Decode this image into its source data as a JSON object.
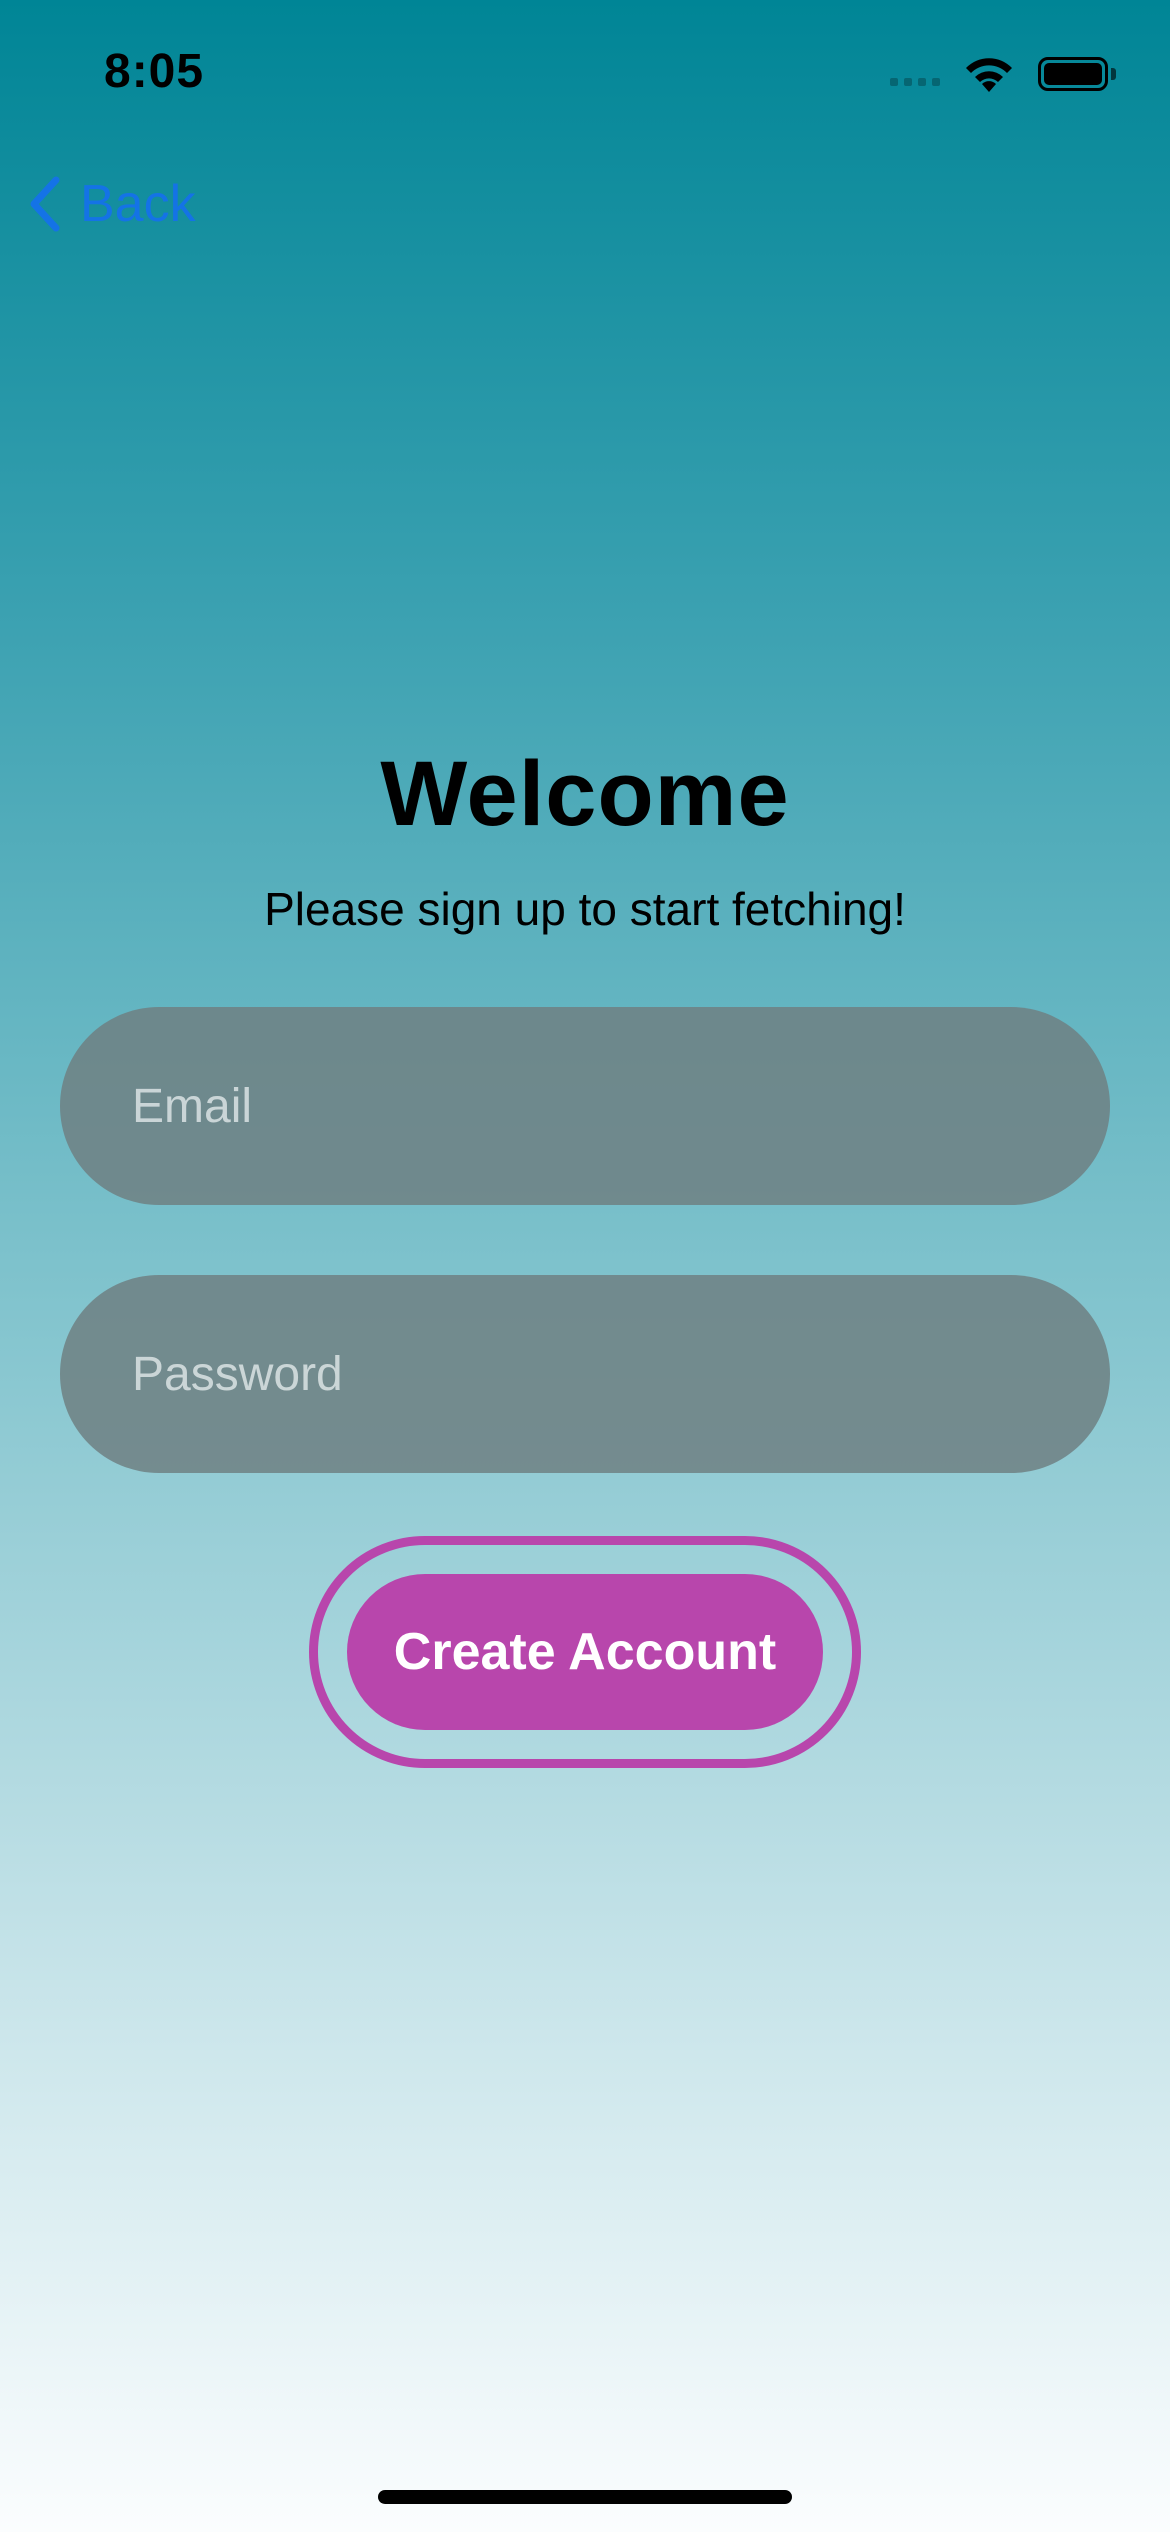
{
  "status_bar": {
    "time": "8:05",
    "icons": [
      "cellular-signal-icon",
      "wifi-icon",
      "battery-icon"
    ]
  },
  "nav": {
    "back_label": "Back",
    "back_icon": "chevron-left-icon",
    "accent_color": "#1473e6"
  },
  "content": {
    "title": "Welcome",
    "subtitle": "Please sign up to start fetching!"
  },
  "form": {
    "email_placeholder": "Email",
    "email_value": "",
    "password_placeholder": "Password",
    "password_value": "",
    "submit_label": "Create Account"
  },
  "colors": {
    "button": "#b846ac",
    "gradient_top": "#008596",
    "gradient_bottom": "#fbfdfe"
  }
}
